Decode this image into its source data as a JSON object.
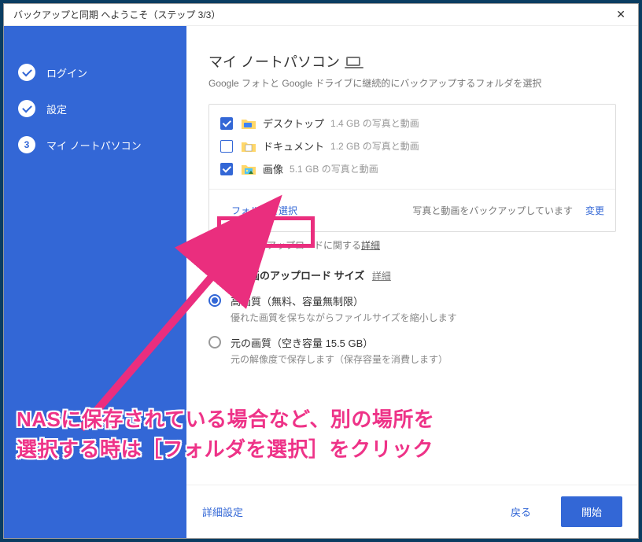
{
  "titlebar": {
    "title": "バックアップと同期 へようこそ（ステップ 3/3）"
  },
  "sidebar": {
    "steps": [
      {
        "label": "ログイン"
      },
      {
        "label": "設定"
      },
      {
        "label": "マイ ノートパソコン"
      }
    ],
    "step3_num": "3"
  },
  "main": {
    "title": "マイ ノートパソコン",
    "subtitle": "Google フォトと Google ドライブに継続的にバックアップするフォルダを選択",
    "folders": [
      {
        "name": "デスクトップ",
        "size": "1.4 GB の写真と動画"
      },
      {
        "name": "ドキュメント",
        "size": "1.2 GB の写真と動画"
      },
      {
        "name": "画像",
        "size": "5.1 GB の写真と動画"
      }
    ],
    "select_folder": "フォルダを選択",
    "backup_status": "写真と動画をバックアップしています",
    "change": "変更",
    "upload_detail_prefix": "写真と動画のアップロードに関する",
    "upload_detail_link": "詳細",
    "upload_section_title": "写真と動画のアップロード サイズ",
    "upload_section_detail": "詳細",
    "quality_options": [
      {
        "title": "高画質（無料、容量無制限）",
        "desc": "優れた画質を保ちながらファイルサイズを縮小します"
      },
      {
        "title": "元の画質（空き容量 15.5 GB）",
        "desc": "元の解像度で保存します（保存容量を消費します）"
      }
    ],
    "adv_settings": "詳細設定",
    "back": "戻る",
    "start": "開始"
  },
  "annotation": {
    "line1": "NASに保存されている場合など、別の場所を",
    "line2": "選択する時は［フォルダを選択］をクリック"
  }
}
